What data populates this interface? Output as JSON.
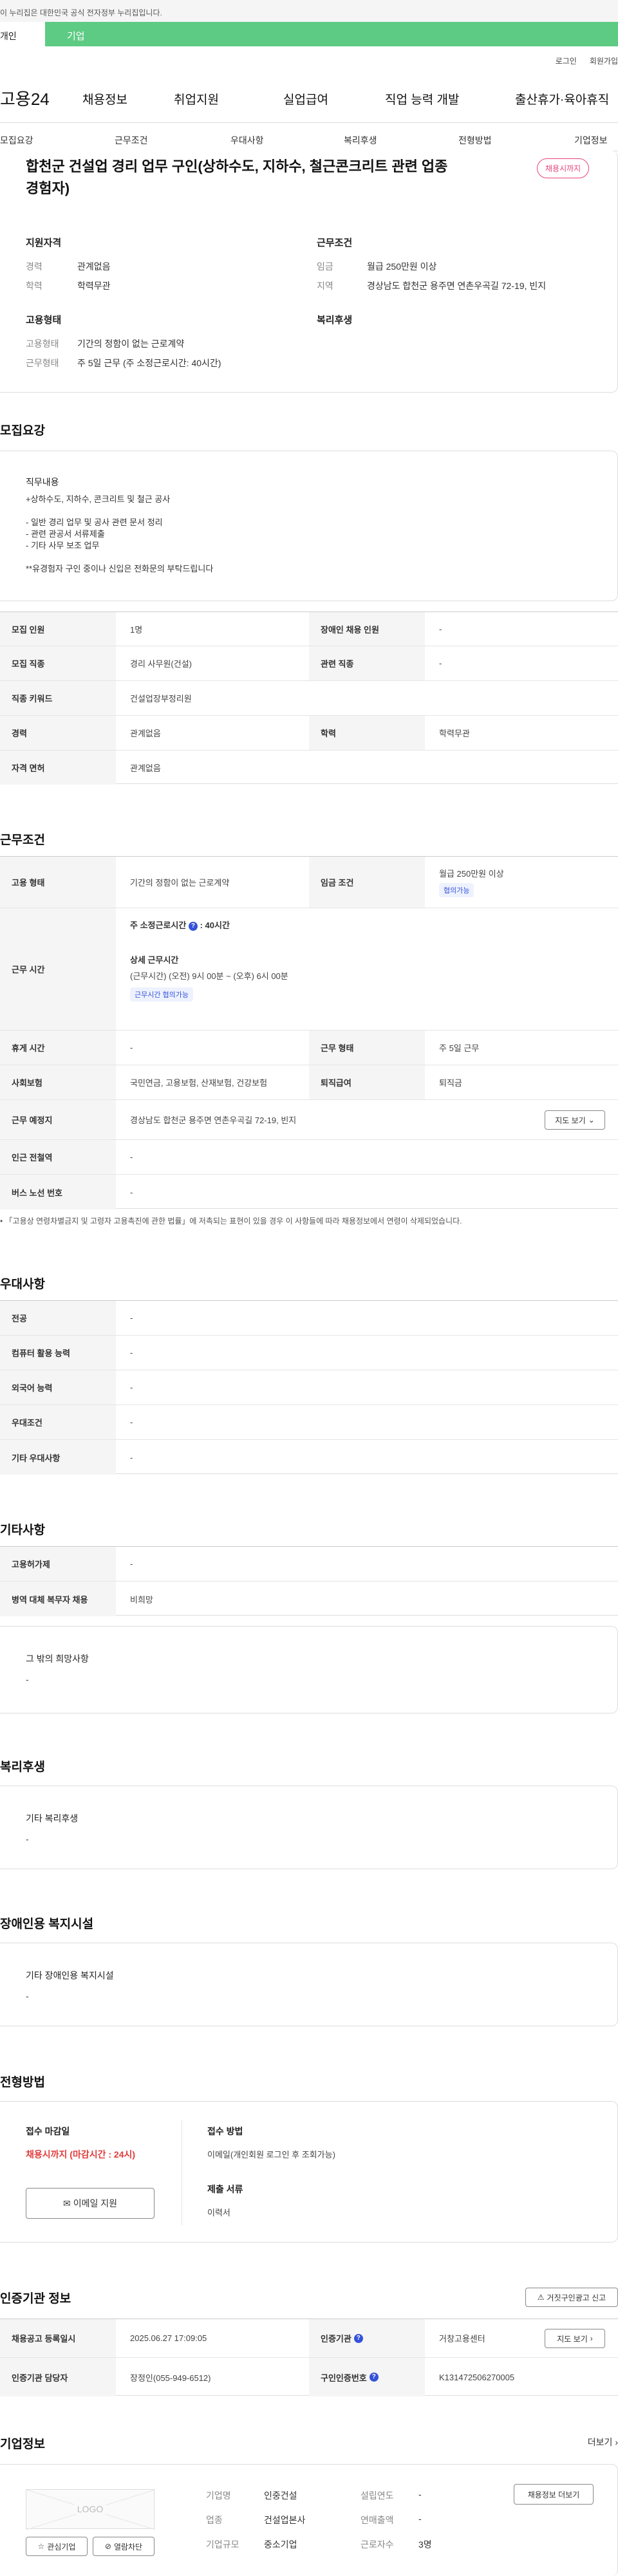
{
  "gov_banner": "이 누리집은 대한민국 공식 전자정부 누리집입니다.",
  "tabs": {
    "personal": "개인",
    "company": "기업"
  },
  "util": {
    "login": "로그인",
    "join": "회원가입"
  },
  "logo": "고용24",
  "gnb": [
    "채용정보",
    "취업지원",
    "실업급여",
    "직업 능력 개발",
    "출산휴가·육아휴직"
  ],
  "lnb": [
    "모집요강",
    "근무조건",
    "우대사항",
    "복리후생",
    "전형방법",
    "기업정보"
  ],
  "job": {
    "title_line1": "합천군 건설업 경리 업무 구인(상하수도, 지하수, 철근콘크리트 관련 업종",
    "title_line2": "경험자)",
    "badge": "채용시까지",
    "qualify_title": "지원자격",
    "career_k": "경력",
    "career_v": "관계없음",
    "edu_k": "학력",
    "edu_v": "학력무관",
    "cond_title": "근무조건",
    "wage_k": "임금",
    "wage_v": "월급 250만원 이상",
    "area_k": "지역",
    "area_v": "경상남도 합천군 용주면 연촌우곡길 72-19, 빈지",
    "emp_title": "고용형태",
    "emptype_k": "고용형태",
    "emptype_v": "기간의 정함이 없는 근로계약",
    "worktype_k": "근무형태",
    "worktype_v": "주 5일 근무 (주 소정근로시간: 40시간)",
    "welfare_title": "복리후생"
  },
  "recruit": {
    "title": "모집요강",
    "desc_title": "직무내용",
    "desc_lines": [
      "+상하수도, 지하수, 콘크리트 및 철근 공사",
      "",
      "- 일반 경리 업무 및 공사 관련 문서 정리",
      "- 관련 관공서 서류제출",
      "- 기타 사무 보조 업무",
      "",
      "**유경험자 구인 중이나 신입은 전화문의 부탁드립니다"
    ],
    "rows": [
      {
        "k1": "모집 인원",
        "v1": "1명",
        "k2": "장애인 채용 인원",
        "v2": "-"
      },
      {
        "k1": "모집 직종",
        "v1": "경리 사무원(건설)",
        "k2": "관련 직종",
        "v2": "-"
      },
      {
        "k1": "직종 키워드",
        "v1": "건설업장부정리원"
      },
      {
        "k1": "경력",
        "v1": "관계없음",
        "k2": "학력",
        "v2": "학력무관"
      },
      {
        "k1": "자격 면허",
        "v1": "관계없음"
      }
    ]
  },
  "work": {
    "title": "근무조건",
    "emp_k": "고용 형태",
    "emp_v": "기간의 정함이 없는 근로계약",
    "wage_k": "임금 조건",
    "wage_v": "월급 250만원 이상",
    "wage_pill": "협의가능",
    "time_k": "근무 시간",
    "time_main": "주 소정근로시간",
    "time_main_v": ": 40시간",
    "time_detail_title": "상세 근무시간",
    "time_detail": "(근무시간) (오전) 9시 00분 ~ (오후) 6시 00분",
    "time_pill": "근무시간 협의가능",
    "rest_k": "휴게 시간",
    "rest_v": "-",
    "form_k": "근무 형태",
    "form_v": "주 5일 근무",
    "ins_k": "사회보험",
    "ins_v": "국민연금, 고용보험, 산재보험, 건강보험",
    "ret_k": "퇴직급여",
    "ret_v": "퇴직금",
    "place_k": "근무 예정지",
    "place_v": "경상남도 합천군 용주면 연촌우곡길 72-19, 빈지",
    "map_btn": "지도 보기",
    "station_k": "인근 전철역",
    "station_v": "-",
    "bus_k": "버스 노선 번호",
    "bus_v": "-",
    "note": "「고용상 연령차별금지 및 고령자 고용촉진에 관한 법률」에 저촉되는 표현이 있을 경우 이 사항들에 따라 채용정보에서 연령이 삭제되었습니다."
  },
  "pref": {
    "title": "우대사항",
    "rows": [
      [
        "전공",
        "-"
      ],
      [
        "컴퓨터 활용 능력",
        "-"
      ],
      [
        "외국어 능력",
        "-"
      ],
      [
        "우대조건",
        "-"
      ],
      [
        "기타 우대사항",
        "-"
      ]
    ]
  },
  "etc": {
    "title": "기타사항",
    "rows": [
      [
        "고용허가제",
        "-"
      ],
      [
        "병역 대체 복무자 채용",
        "비희망"
      ]
    ],
    "other_title": "그 밖의 희망사항",
    "other_v": "-"
  },
  "welfare": {
    "title": "복리후생",
    "box_title": "기타 복리후생",
    "box_v": "-"
  },
  "disabled": {
    "title": "장애인용 복지시설",
    "box_title": "기타 장애인용 복지시설",
    "box_v": "-"
  },
  "selection": {
    "title": "전형방법",
    "deadline_k": "접수 마감일",
    "deadline_v": "채용시까지 (마감시간 : 24시)",
    "method_k": "접수 방법",
    "method_v": "이메일(개인회원 로그인 후 조회가능)",
    "docs_k": "제출 서류",
    "docs_v": "이력서",
    "email_btn": "이메일 지원"
  },
  "agency": {
    "title": "인증기관 정보",
    "report_btn": "거짓구인광고 신고",
    "reg_k": "채용공고 등록일시",
    "reg_v": "2025.06.27 17:09:05",
    "org_k": "인증기관",
    "org_v": "거창고용센터",
    "map_btn": "지도 보기",
    "mgr_k": "인증기관 담당자",
    "mgr_v": "장정인(055-949-6512)",
    "num_k": "구인인증번호",
    "num_v": "K131472506270005"
  },
  "company": {
    "title": "기업정보",
    "more": "더보기",
    "logo_text": "LOGO",
    "fav_btn": "관심기업",
    "block_btn": "열람차단",
    "name_k": "기업명",
    "name_v": "인중건설",
    "ind_k": "업종",
    "ind_v": "건설업본사",
    "size_k": "기업규모",
    "size_v": "중소기업",
    "est_k": "설립연도",
    "est_v": "-",
    "sales_k": "연매출액",
    "sales_v": "-",
    "emp_k": "근로자수",
    "emp_v": "3명",
    "jobs_btn": "채용정보 더보기"
  }
}
